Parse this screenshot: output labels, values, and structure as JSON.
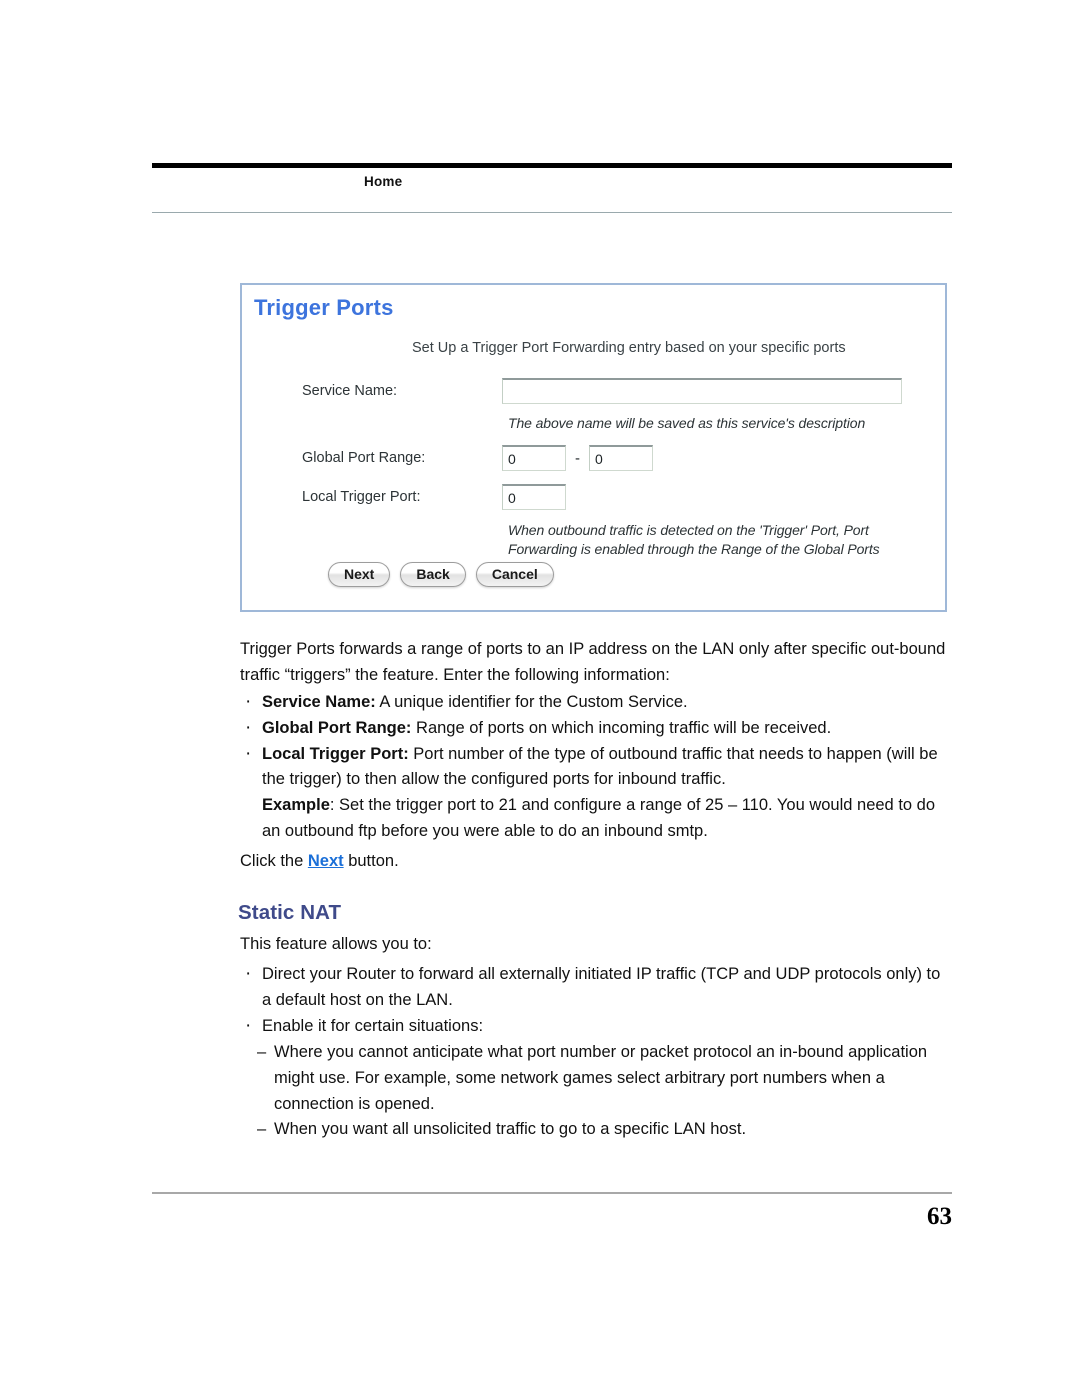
{
  "header": {
    "running_head": "Home"
  },
  "screenshot": {
    "title": "Trigger Ports",
    "subtitle": "Set Up a Trigger Port Forwarding entry based on your specific ports",
    "fields": {
      "service_name_label": "Service Name:",
      "service_name_value": "",
      "service_name_hint": "The above name will be saved as this service's description",
      "global_port_range_label": "Global Port Range:",
      "global_port_range_from": "0",
      "global_port_range_separator": "-",
      "global_port_range_to": "0",
      "local_trigger_port_label": "Local Trigger Port:",
      "local_trigger_port_value": "0"
    },
    "note_line1": "When outbound traffic is detected on the 'Trigger' Port, Port",
    "note_line2": "Forwarding is enabled through the Range of the Global Ports",
    "buttons": {
      "next": "Next",
      "back": "Back",
      "cancel": "Cancel"
    },
    "colors": {
      "title": "#3d74dd",
      "border": "#9fb8d8"
    }
  },
  "body": {
    "intro": "Trigger Ports forwards a range of ports to an IP address on the LAN only after specific out-bound traffic “triggers” the feature. Enter the following information:",
    "bullets": [
      {
        "lead": "Service Name:",
        "text": " A unique identifier for the Custom Service."
      },
      {
        "lead": "Global Port Range:",
        "text": " Range of ports on which incoming traffic will be received."
      },
      {
        "lead": "Local Trigger Port:",
        "text": " Port number of the type of outbound traffic that needs to happen (will be the trigger) to then allow the configured ports for inbound traffic."
      }
    ],
    "example_lead": "Example",
    "example_text": ": Set the trigger port to 21 and configure a range of 25 – 110. You would need to do an outbound ftp before you were able to do an inbound smtp.",
    "click_prefix": "Click the ",
    "click_link": "Next",
    "click_suffix": " button."
  },
  "static_nat": {
    "heading": "Static NAT",
    "heading_color": "#3f4a8a",
    "intro": "This feature allows you to:",
    "bullets": [
      "Direct your Router to forward all externally initiated IP traffic (TCP and UDP protocols only) to a default host on the LAN.",
      " Enable it for certain situations:"
    ],
    "sub_items": [
      "Where you cannot anticipate what port number or packet protocol an in-bound application might use. For example, some network games select arbitrary port numbers when a connection is opened.",
      "When you want all unsolicited traffic to go to a specific LAN host."
    ]
  },
  "footer": {
    "page_number": "63"
  }
}
